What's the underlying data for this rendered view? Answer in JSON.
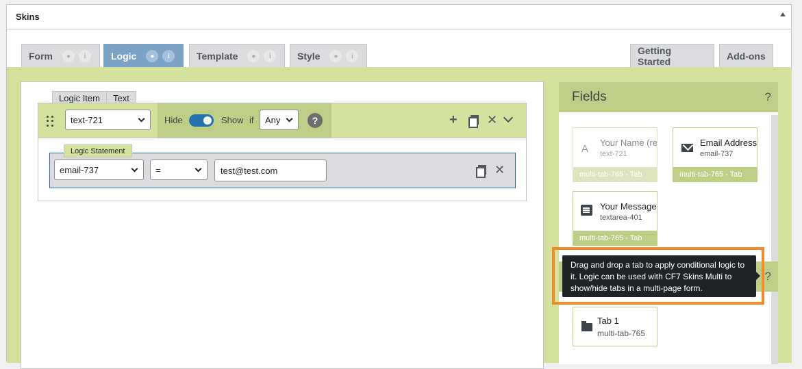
{
  "panel": {
    "title": "Skins"
  },
  "tabs_left": [
    {
      "label": "Form",
      "active": false
    },
    {
      "label": "Logic",
      "active": true
    },
    {
      "label": "Template",
      "active": false
    },
    {
      "label": "Style",
      "active": false
    }
  ],
  "tabs_right": [
    {
      "label": "Getting Started"
    },
    {
      "label": "Add-ons"
    }
  ],
  "logic_item": {
    "labels": [
      "Logic Item",
      "Text"
    ],
    "field_select": "text-721",
    "hide_label": "Hide",
    "show_label": "Show",
    "if_label": "if",
    "match_select": "Any",
    "help": "?",
    "toggle_on": true
  },
  "statement": {
    "label": "Logic Statement",
    "field_select": "email-737",
    "operator_select": "=",
    "value": "test@test.com"
  },
  "fields": {
    "title": "Fields",
    "help": "?",
    "items": [
      {
        "name": "Your Name (re",
        "tag": "text-721",
        "tab": "multi-tab-765 - Tab",
        "icon": "A"
      },
      {
        "name": "Email Address",
        "tag": "email-737",
        "tab": "multi-tab-765 - Tab"
      },
      {
        "name": "Your Message",
        "tag": "textarea-401",
        "tab": "multi-tab-765 - Tab"
      }
    ]
  },
  "tabs_section": {
    "help": "?",
    "items": [
      {
        "name": "Tab 1",
        "tag": "multi-tab-765"
      }
    ]
  },
  "tooltip": {
    "text": "Drag and drop a tab to apply conditional logic to it. Logic can be used with CF7 Skins Multi to show/hide tabs in a multi-page form."
  },
  "colors": {
    "accent_green": "#d4e29e",
    "active_tab": "#7aa3c6",
    "toggle_blue": "#2271b1",
    "highlight_orange": "#f28c28"
  }
}
